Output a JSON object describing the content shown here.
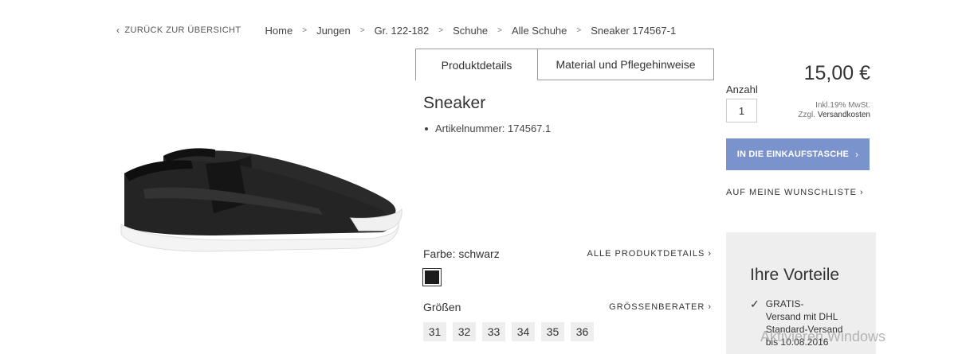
{
  "breadcrumb": {
    "back_label": "ZURÜCK ZUR ÜBERSICHT",
    "items": [
      "Home",
      "Jungen",
      "Gr. 122-182",
      "Schuhe",
      "Alle Schuhe",
      "Sneaker 174567-1"
    ],
    "separator": ">"
  },
  "tabs": [
    {
      "label": "Produktdetails",
      "active": true
    },
    {
      "label": "Material und Pflegehinweise",
      "active": false
    }
  ],
  "product": {
    "title": "Sneaker",
    "article": "Artikelnummer: 174567.1",
    "color_label": "Farbe: schwarz",
    "color_swatch": "#1c1c1c",
    "all_details_link": "ALLE PRODUKTDETAILS",
    "sizes_label": "Größen",
    "size_guide_link": "GRÖSSENBERATER",
    "sizes": [
      "31",
      "32",
      "33",
      "34",
      "35",
      "36"
    ]
  },
  "purchase": {
    "price": "15,00 €",
    "qty_label": "Anzahl",
    "qty_value": "1",
    "tax_note": "Inkl.19% MwSt.",
    "shipping_prefix": "Zzgl.",
    "shipping_link": "Versandkosten",
    "cart_button": "IN DIE EINKAUFSTASCHE",
    "wishlist_link": "AUF MEINE WUNSCHLISTE",
    "accent": "#7b93cc"
  },
  "benefits": {
    "title": "Ihre Vorteile",
    "item": "GRATIS-\nVersand mit DHL\nStandard-Versand\nbis 10.08.2016"
  },
  "watermark": "Aktivieren Windows"
}
